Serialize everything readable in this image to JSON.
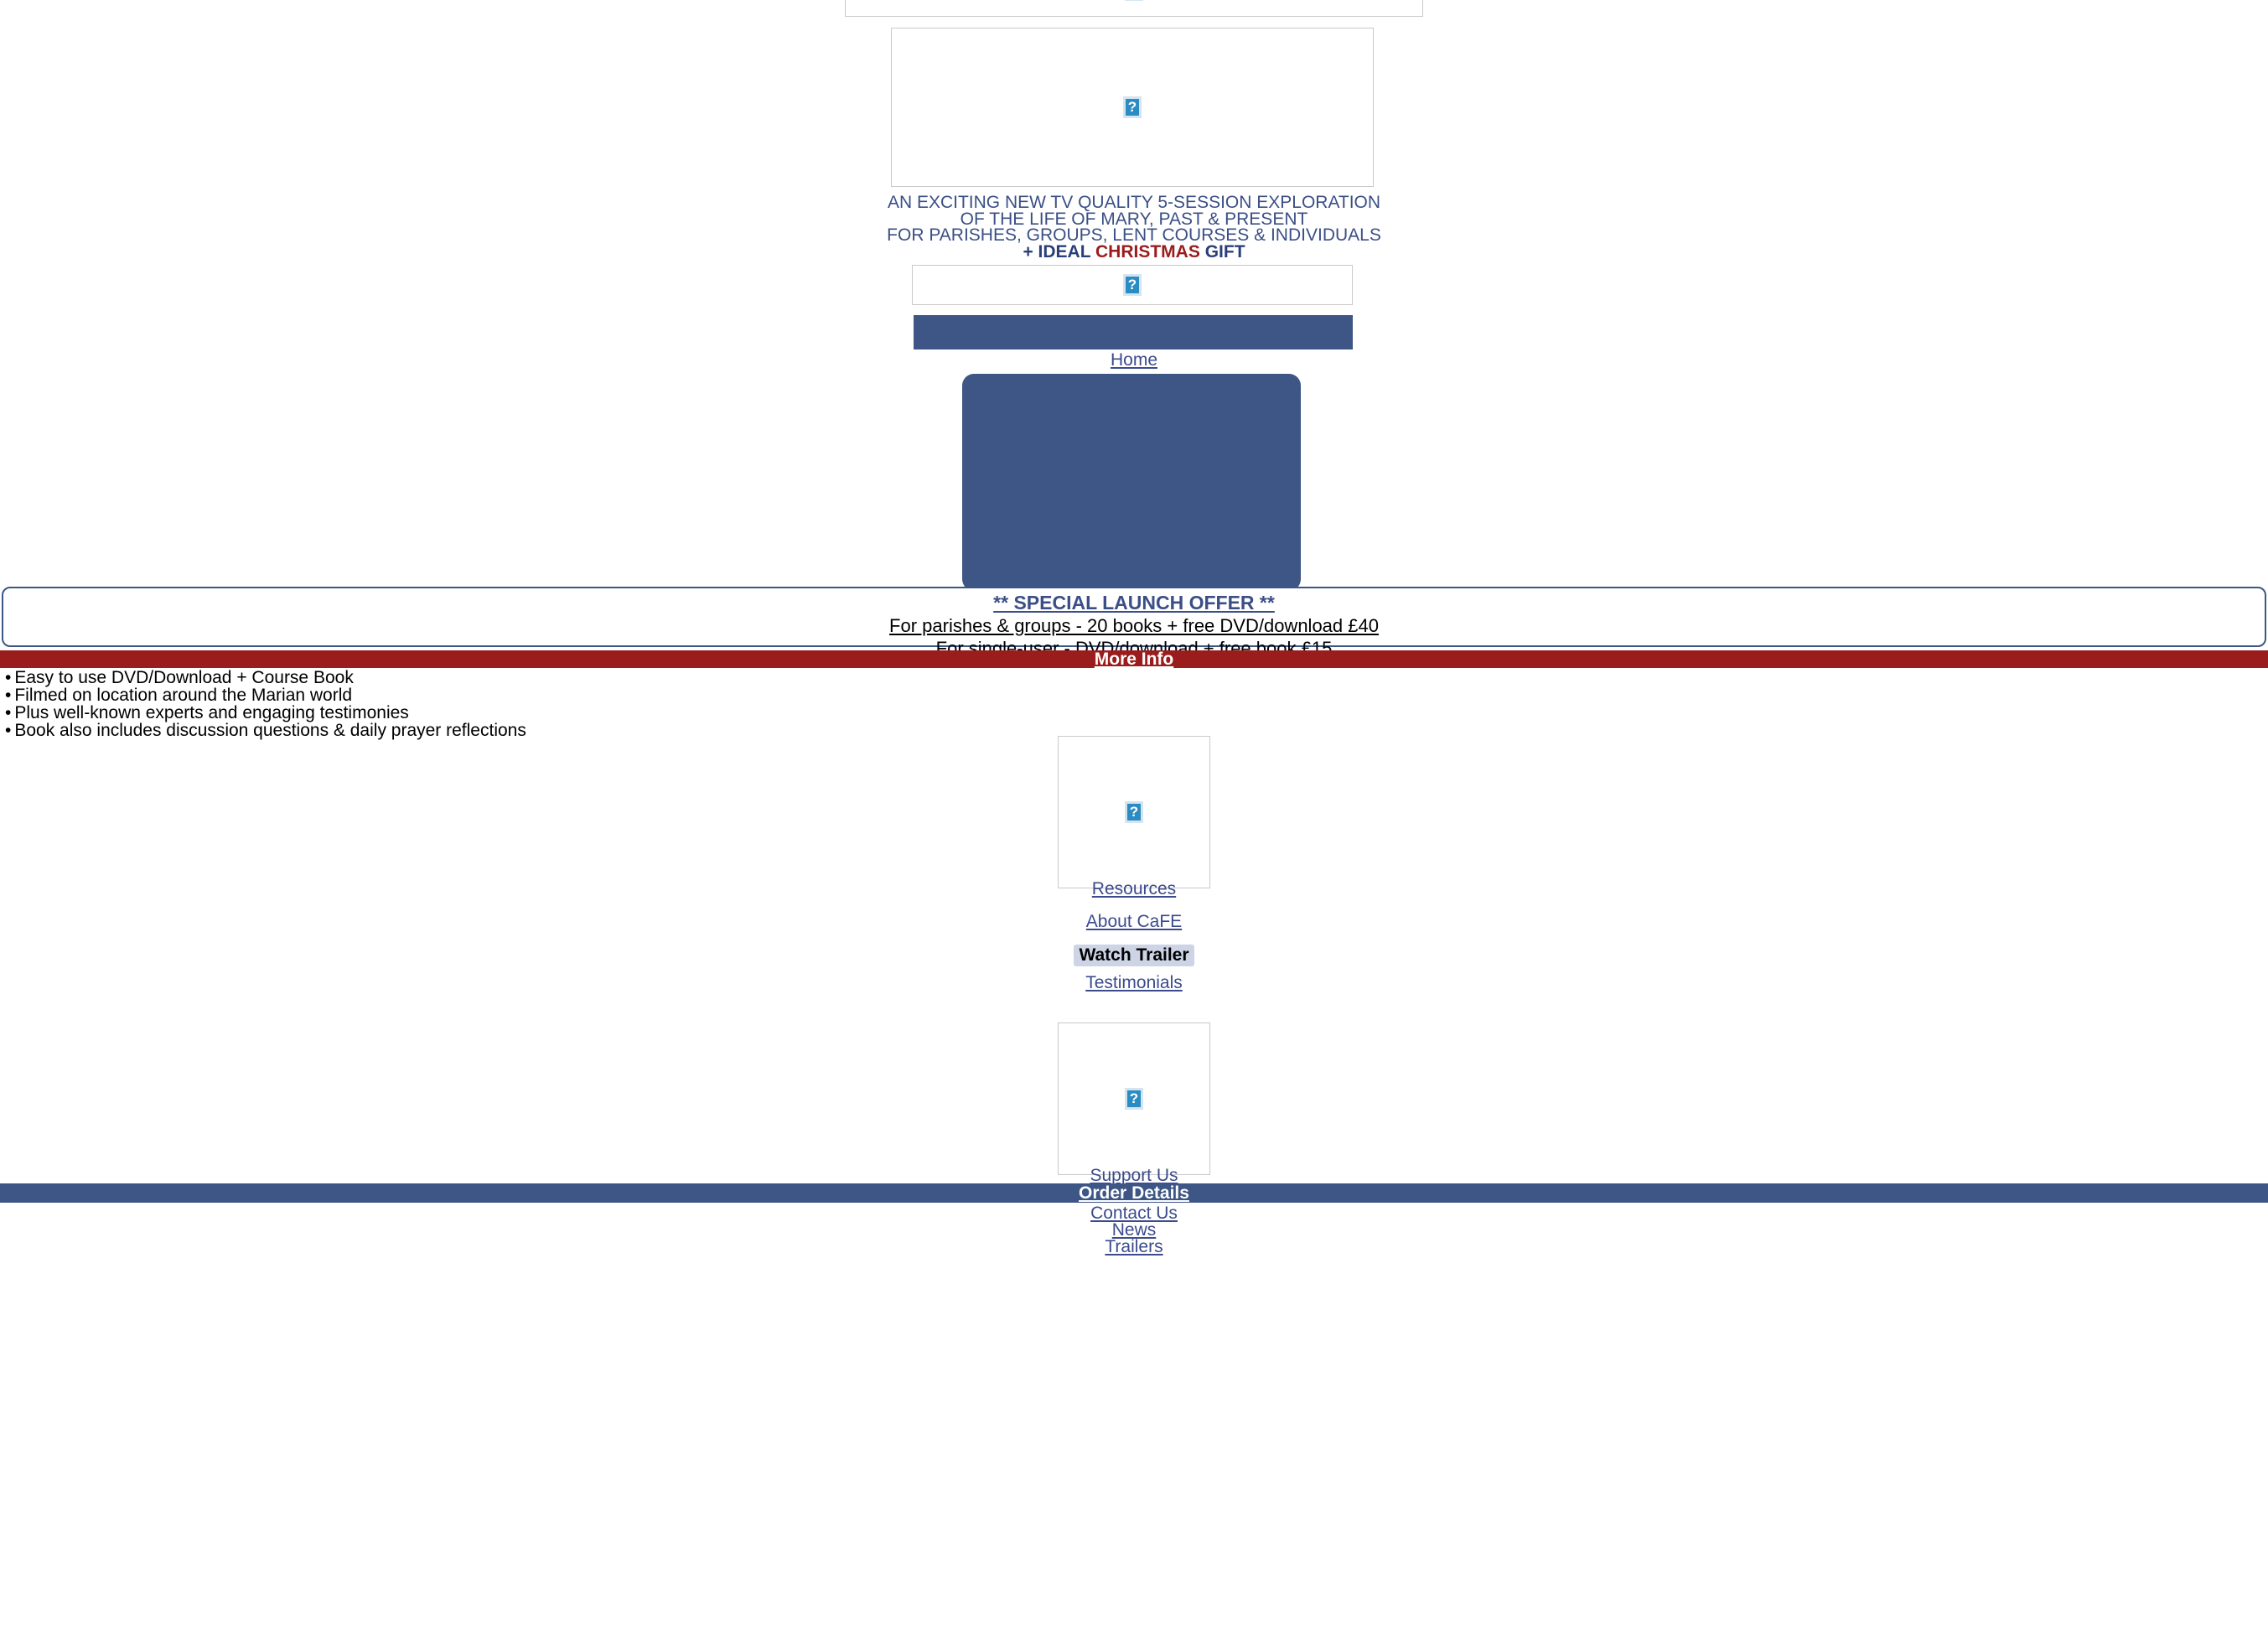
{
  "page": {
    "background": "#ffffff",
    "accent_blue": "#3d5685",
    "accent_red": "#9b1c1c",
    "link_color": "#3b4b8c"
  },
  "media": {
    "broken_icon_glyph": "?",
    "banner_top_alt": "broken-image",
    "hero_alt": "broken-image",
    "logo_strip_alt": "broken-image",
    "resources_thumb_alt": "broken-image",
    "support_thumb_alt": "broken-image"
  },
  "headline": {
    "line1": "AN EXCITING NEW TV QUALITY 5-SESSION EXPLORATION",
    "line2": "OF THE LIFE OF MARY, PAST & PRESENT",
    "line3": "FOR PARISHES, GROUPS, LENT COURSES & INDIVIDUALS",
    "gift_prefix": "+ IDEAL ",
    "gift_highlight": "CHRISTMAS",
    "gift_suffix": " GIFT"
  },
  "offer": {
    "title": "** SPECIAL LAUNCH OFFER **",
    "line1": "For parishes & groups - 20 books + free DVD/download £40",
    "line2": "For single-user - DVD/download + free book £15",
    "more_info": "More Info"
  },
  "features": {
    "items": [
      "Easy to use DVD/Download + Course Book",
      "Filmed on location around the Marian world",
      "Plus well-known experts and engaging testimonies",
      "Book also includes discussion questions & daily prayer reflections"
    ],
    "bullet": "•"
  },
  "nav": {
    "home": "Home",
    "resources": "Resources",
    "about": "About CaFE",
    "watch_trailer": "Watch Trailer",
    "testimonials": "Testimonials",
    "support_us": "Support Us",
    "order_details": "Order Details",
    "contact_us": "Contact Us",
    "news": "News",
    "trailers": "Trailers"
  }
}
